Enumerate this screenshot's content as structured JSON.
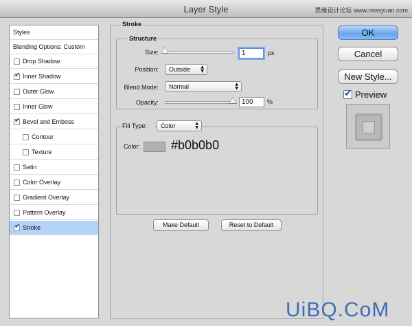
{
  "window": {
    "title": "Layer Style"
  },
  "watermark": {
    "top_right": "思缘设计论坛 www.missyuan.com",
    "bottom": "UiBQ.CoM"
  },
  "styles_list": {
    "header": "Styles",
    "blending": "Blending Options: Custom",
    "items": [
      {
        "label": "Drop Shadow",
        "checked": false,
        "indent": false,
        "selected": false
      },
      {
        "label": "Inner Shadow",
        "checked": true,
        "indent": false,
        "selected": false
      },
      {
        "label": "Outer Glow",
        "checked": false,
        "indent": false,
        "selected": false
      },
      {
        "label": "Inner Glow",
        "checked": false,
        "indent": false,
        "selected": false
      },
      {
        "label": "Bevel and Emboss",
        "checked": true,
        "indent": false,
        "selected": false
      },
      {
        "label": "Contour",
        "checked": false,
        "indent": true,
        "selected": false
      },
      {
        "label": "Texture",
        "checked": false,
        "indent": true,
        "selected": false
      },
      {
        "label": "Satin",
        "checked": false,
        "indent": false,
        "selected": false
      },
      {
        "label": "Color Overlay",
        "checked": false,
        "indent": false,
        "selected": false
      },
      {
        "label": "Gradient Overlay",
        "checked": false,
        "indent": false,
        "selected": false
      },
      {
        "label": "Pattern Overlay",
        "checked": false,
        "indent": false,
        "selected": false
      },
      {
        "label": "Stroke",
        "checked": true,
        "indent": false,
        "selected": true
      }
    ]
  },
  "stroke": {
    "title": "Stroke",
    "structure_title": "Structure",
    "size": {
      "label": "Size:",
      "value": "1",
      "unit": "px",
      "fraction": 0.0
    },
    "position": {
      "label": "Position:",
      "value": "Outside"
    },
    "blend_mode": {
      "label": "Blend Mode:",
      "value": "Normal"
    },
    "opacity": {
      "label": "Opacity:",
      "value": "100",
      "unit": "%",
      "fraction": 1.0
    },
    "fill_type": {
      "label": "Fill Type:",
      "value": "Color"
    },
    "color": {
      "label": "Color:",
      "hex_text": "#b0b0b0",
      "swatch": "#b0b0b0"
    },
    "make_default": "Make Default",
    "reset_default": "Reset to Default"
  },
  "actions": {
    "ok": "OK",
    "cancel": "Cancel",
    "new_style": "New Style...",
    "preview_label": "Preview",
    "preview_checked": true
  }
}
